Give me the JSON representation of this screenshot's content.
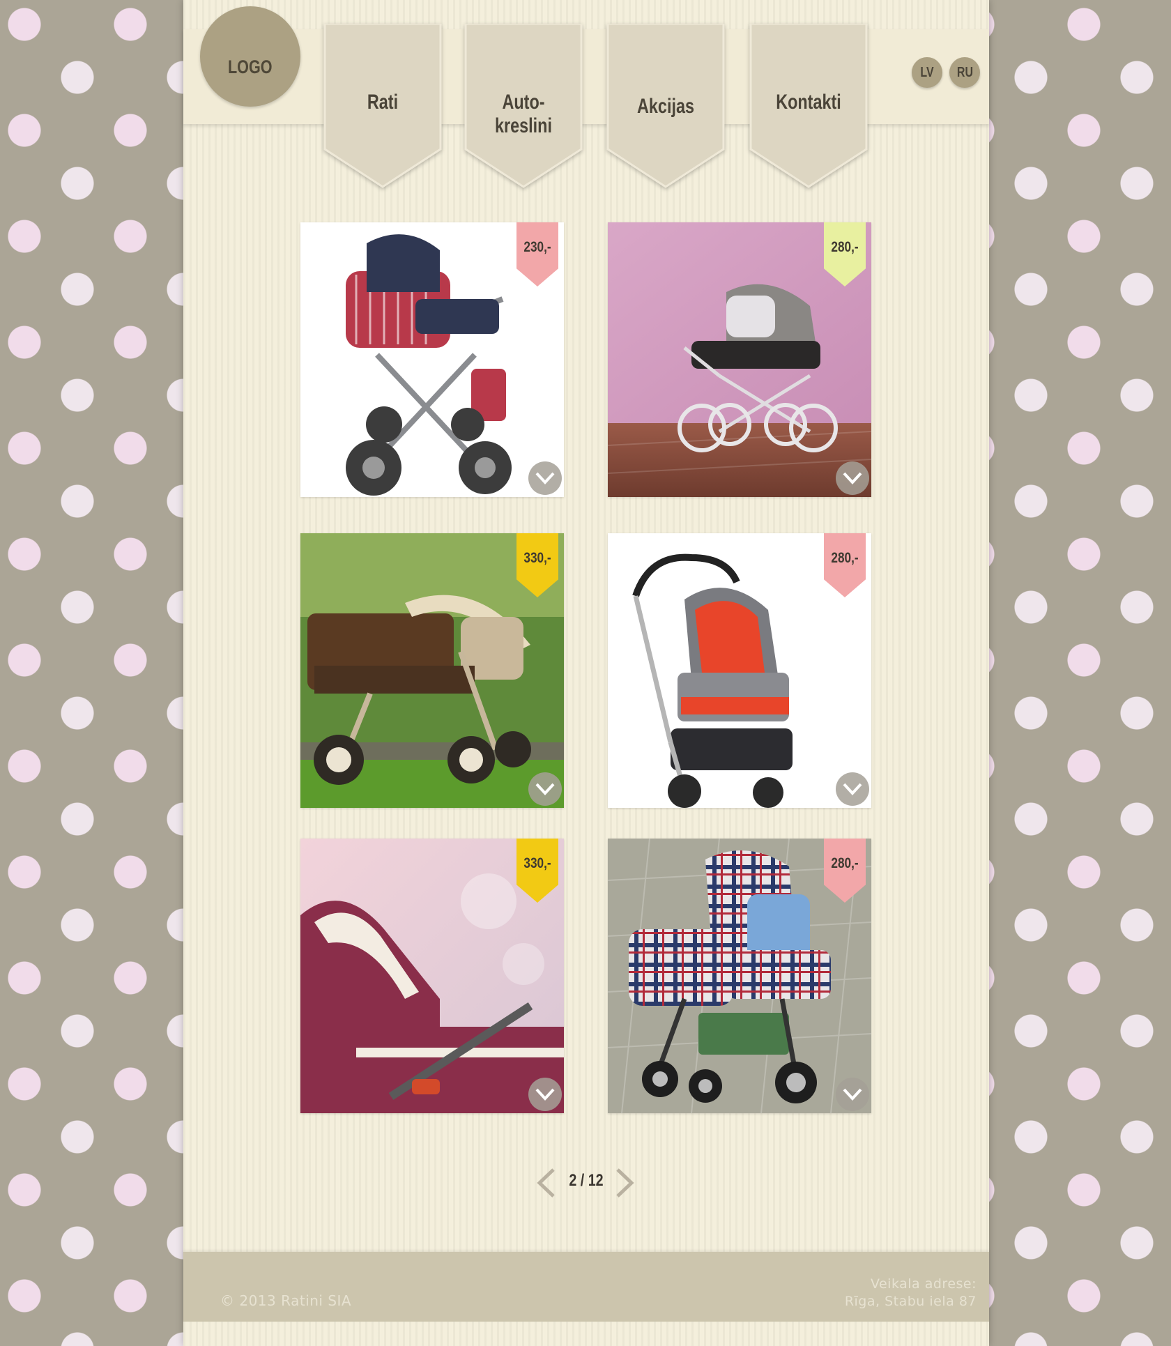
{
  "header": {
    "logo_text": "LOGO",
    "nav": [
      {
        "label": "Rati"
      },
      {
        "label": "Auto-kreslini"
      },
      {
        "label": "Akcijas"
      },
      {
        "label": "Kontakti"
      }
    ],
    "languages": [
      "LV",
      "RU"
    ]
  },
  "products": [
    {
      "price": "230,-",
      "tag_color": "#f2a7a9"
    },
    {
      "price": "280,-",
      "tag_color": "#e8f0a0"
    },
    {
      "price": "330,-",
      "tag_color": "#f2ca14"
    },
    {
      "price": "280,-",
      "tag_color": "#f2a7a9"
    },
    {
      "price": "330,-",
      "tag_color": "#f2ca14"
    },
    {
      "price": "280,-",
      "tag_color": "#f2a7a9"
    }
  ],
  "pagination": {
    "text": "2 / 12",
    "prev_icon": "chevron-left-icon",
    "next_icon": "chevron-right-icon"
  },
  "footer": {
    "copyright": "© 2013 Ratini SIA",
    "address_title": "Veikala adrese:",
    "address": "Rīga, Stabu iela 87"
  },
  "colors": {
    "background": "#aba596",
    "page": "#f4efdc",
    "nav_tab": "#ddd6c2",
    "logo": "#aca183",
    "footer": "#ccc5ad"
  }
}
